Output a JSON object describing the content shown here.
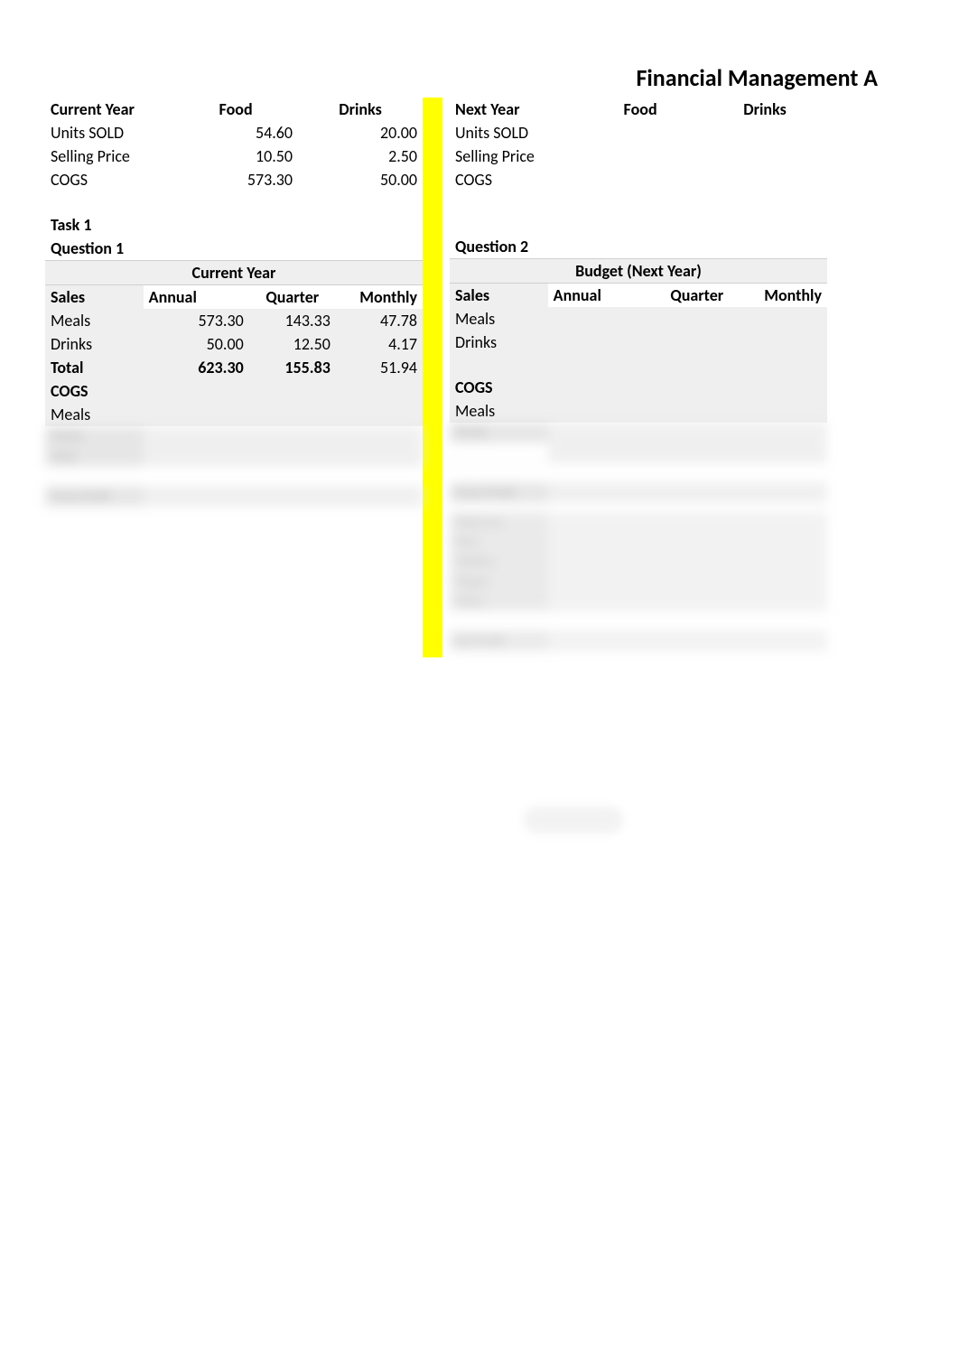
{
  "page_title": "Financial Management A",
  "current_year": {
    "header": "Current Year",
    "col_food": "Food",
    "col_drinks": "Drinks",
    "rows": {
      "units_sold": {
        "label": "Units SOLD",
        "food": "54.60",
        "drinks": "20.00"
      },
      "selling_price": {
        "label": "Selling Price",
        "food": "10.50",
        "drinks": "2.50"
      },
      "cogs": {
        "label": "COGS",
        "food": "573.30",
        "drinks": "50.00"
      }
    }
  },
  "next_year": {
    "header": "Next Year",
    "col_food": "Food",
    "col_drinks": "Drinks",
    "rows": {
      "units_sold": {
        "label": "Units SOLD"
      },
      "selling_price": {
        "label": "Selling Price"
      },
      "cogs": {
        "label": "COGS"
      }
    }
  },
  "task1": {
    "title": "Task 1",
    "q1": {
      "label": "Question 1",
      "subheader": "Current Year",
      "cols": {
        "sales": "Sales",
        "annual": "Annual",
        "quarter": "Quarter",
        "monthly": "Monthly"
      },
      "meals": {
        "label": "Meals",
        "annual": "573.30",
        "quarter": "143.33",
        "monthly": "47.78"
      },
      "drinks": {
        "label": "Drinks",
        "annual": "50.00",
        "quarter": "12.50",
        "monthly": "4.17"
      },
      "total": {
        "label": "Total",
        "annual": "623.30",
        "quarter": "155.83",
        "monthly": "51.94"
      },
      "cogs": {
        "label": "COGS"
      },
      "cogs_meals": {
        "label": "Meals"
      }
    },
    "q2": {
      "label": "Question 2",
      "subheader": "Budget (Next Year)",
      "cols": {
        "sales": "Sales",
        "annual": "Annual",
        "quarter": "Quarter",
        "monthly": "Monthly"
      },
      "meals": {
        "label": "Meals"
      },
      "drinks": {
        "label": "Drinks"
      },
      "cogs": {
        "label": "COGS"
      },
      "cogs_meals": {
        "label": "Meals"
      }
    }
  }
}
